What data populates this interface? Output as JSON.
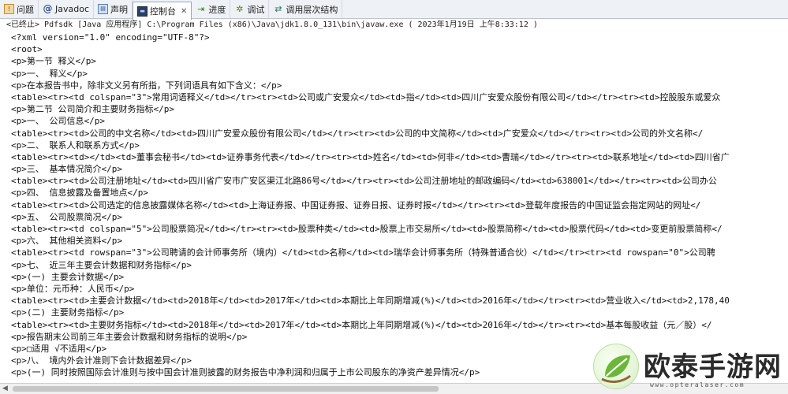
{
  "tabs": [
    {
      "label": "问题",
      "icon": "problems-icon",
      "active": false
    },
    {
      "label": "Javadoc",
      "icon": "javadoc-icon",
      "active": false
    },
    {
      "label": "声明",
      "icon": "declaration-icon",
      "active": false
    },
    {
      "label": "控制台",
      "icon": "console-icon",
      "active": true,
      "close": "✕"
    },
    {
      "label": "进度",
      "icon": "progress-icon",
      "active": false
    },
    {
      "label": "调试",
      "icon": "debug-icon",
      "active": false
    },
    {
      "label": "调用层次结构",
      "icon": "call-hierarchy-icon",
      "active": false
    }
  ],
  "status": "<已终止> Pdfsdk [Java 应用程序] C:\\Program Files (x86)\\Java\\jdk1.8.0_131\\bin\\javaw.exe ( 2023年1月19日 上午8:33:12 )",
  "console_lines": [
    "<?xml version=\"1.0\" encoding=\"UTF-8\"?>",
    "<root>",
    "<p>第一节 释义</p>",
    "<p>一、 释义</p>",
    "<p>在本报告书中，除非文义另有所指，下列词语具有如下含义：</p>",
    "<table><tr><td colspan=\"3\">常用词语释义</td></tr><tr><td>公司或广安爱众</td><td>指</td><td>四川广安爱众股份有限公司</td></tr><tr><td>控股股东或爱众",
    "<p>第二节 公司简介和主要财务指标</p>",
    "<p>一、 公司信息</p>",
    "<table><tr><td>公司的中文名称</td><td>四川广安爱众股份有限公司</td></tr><tr><td>公司的中文简称</td><td>广安爱众</td></tr><tr><td>公司的外文名称</",
    "<p>二、 联系人和联系方式</p>",
    "<table><tr><td></td><td>董事会秘书</td><td>证券事务代表</td></tr><tr><td>姓名</td><td>何非</td><td>曹瑞</td></tr><tr><td>联系地址</td><td>四川省广",
    "<p>三、 基本情况简介</p>",
    "<table><tr><td>公司注册地址</td><td>四川省广安市广安区渠江北路86号</td></tr><tr><td>公司注册地址的邮政编码</td><td>638001</td></tr><tr><td>公司办公",
    "<p>四、 信息披露及备置地点</p>",
    "<table><tr><td>公司选定的信息披露媒体名称</td><td>上海证券报、中国证券报、证券日报、证券时报</td></tr><tr><td>登载年度报告的中国证监会指定网站的网址</",
    "<p>五、 公司股票简况</p>",
    "<table><tr><td colspan=\"5\">公司股票简况</td></tr><tr><td>股票种类</td><td>股票上市交易所</td><td>股票简称</td><td>股票代码</td><td>变更前股票简称</",
    "<p>六、 其他相关资料</p>",
    "<table><tr><td rowspan=\"3\">公司聘请的会计师事务所（境内）</td><td>名称</td><td>瑞华会计师事务所（特殊普通合伙）</td></tr><tr><td rowspan=\"0\">公司聘",
    "<p>七、 近三年主要会计数据和财务指标</p>",
    "<p>(一) 主要会计数据</p>",
    "<p>单位：元币种：人民币</p>",
    "<table><tr><td>主要会计数据</td><td>2018年</td><td>2017年</td><td>本期比上年同期增减(%)</td><td>2016年</td></tr><tr><td>营业收入</td><td>2,178,40",
    "<p>(二) 主要财务指标</p>",
    "<table><tr><td>主要财务指标</td><td>2018年</td><td>2017年</td><td>本期比上年同期增减(%)</td><td>2016年</td></tr><tr><td>基本每股收益（元／股）</",
    "<p>报告期末公司前三年主要会计数据和财务指标的说明</p>",
    "<p>□适用 √不适用</p>",
    "<p>八、 境内外会计准则下会计数据差异</p>",
    "<p>(一) 同时按照国际会计准则与按中国会计准则披露的财务报告中净利润和归属于上市公司股东的净资产差异情况</p>"
  ],
  "watermark": {
    "text": "欧泰手游网",
    "url": "www.opteralaser.com"
  }
}
